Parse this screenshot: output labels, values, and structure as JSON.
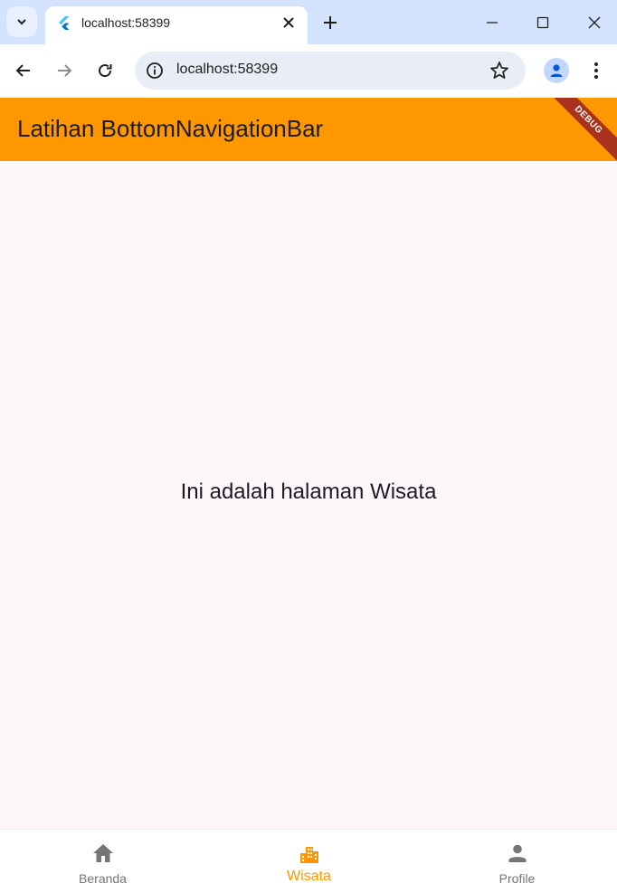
{
  "browser": {
    "tab_title": "localhost:58399",
    "url": "localhost:58399"
  },
  "app": {
    "title": "Latihan BottomNavigationBar",
    "debug_banner": "DEBUG",
    "body_text": "Ini adalah halaman Wisata",
    "accent_color": "#ff9800",
    "bottom_nav": [
      {
        "label": "Beranda",
        "icon": "home-icon",
        "active": false
      },
      {
        "label": "Wisata",
        "icon": "city-icon",
        "active": true
      },
      {
        "label": "Profile",
        "icon": "person-icon",
        "active": false
      }
    ]
  }
}
